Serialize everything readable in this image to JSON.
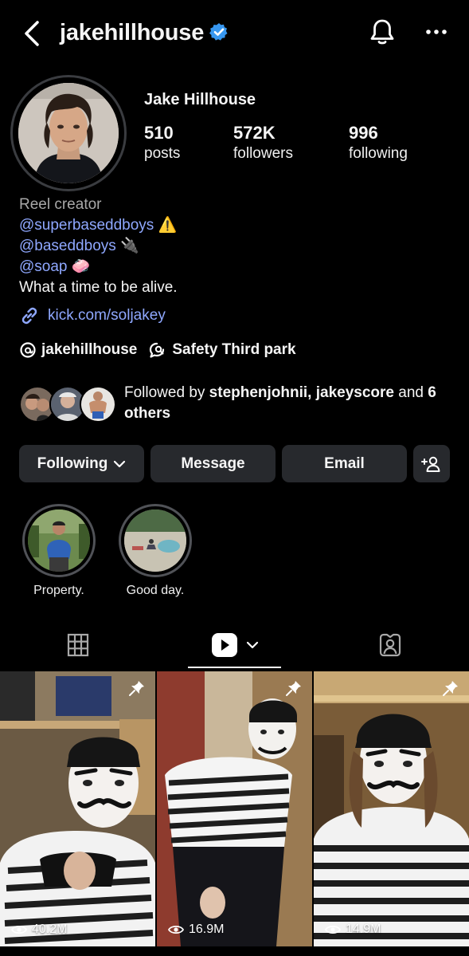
{
  "header": {
    "username": "jakehillhouse",
    "icons": [
      "back-chevron-icon",
      "verified-badge-icon",
      "bell-icon",
      "more-dots-icon"
    ]
  },
  "profile": {
    "full_name": "Jake Hillhouse",
    "stats": [
      {
        "value": "510",
        "label": "posts"
      },
      {
        "value": "572K",
        "label": "followers"
      },
      {
        "value": "996",
        "label": "following"
      }
    ]
  },
  "bio": {
    "category": "Reel creator",
    "mentions": [
      {
        "handle": "@superbaseddboys",
        "emoji": "⚠️"
      },
      {
        "handle": "@baseddboys",
        "emoji": "🔌"
      },
      {
        "handle": "@soap",
        "emoji": "🧼"
      }
    ],
    "tagline": "What a time to be alive.",
    "link": "kick.com/soljakey",
    "threads_handle": "jakehillhouse",
    "location": "Safety Third park"
  },
  "followed_by": {
    "prefix": "Followed by ",
    "names": "stephenjohnii, jakeyscore",
    "middle": " and",
    "others": "6 others"
  },
  "actions": {
    "following": "Following",
    "message": "Message",
    "email": "Email"
  },
  "highlights": [
    {
      "label": "Property."
    },
    {
      "label": "Good day."
    }
  ],
  "grid": [
    {
      "views": "40.2M"
    },
    {
      "views": "16.9M"
    },
    {
      "views": "14.9M"
    }
  ],
  "colors": {
    "background": "#000000",
    "button": "#27292d",
    "mention": "#8fa8ff",
    "verified": "#3797f0"
  }
}
